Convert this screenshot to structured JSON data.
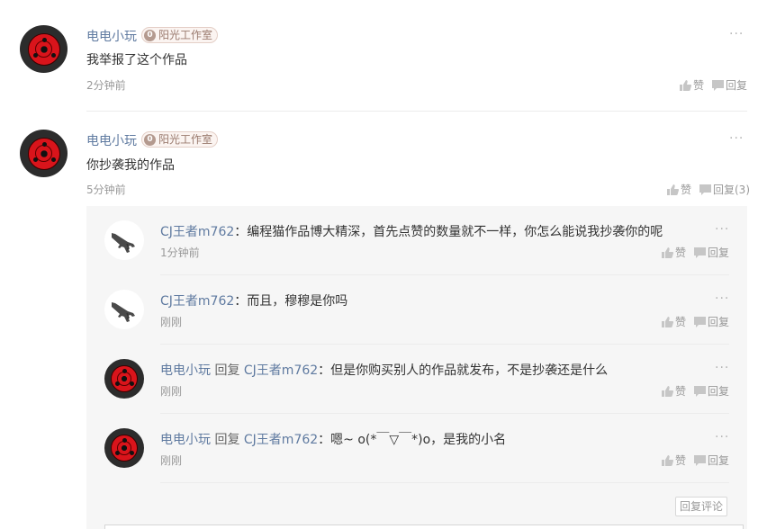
{
  "comments": [
    {
      "username": "电电小玩",
      "level": "0",
      "studio": "阳光工作室",
      "text": "我举报了这个作品",
      "time": "2分钟前",
      "like_label": "赞",
      "reply_label": "回复"
    },
    {
      "username": "电电小玩",
      "level": "0",
      "studio": "阳光工作室",
      "text": "你抄袭我的作品",
      "time": "5分钟前",
      "like_label": "赞",
      "reply_label": "回复(3)"
    }
  ],
  "replies": [
    {
      "username": "CJ王者m762",
      "reply_word": "",
      "reply_to": "",
      "text": "：编程猫作品博大精深，首先点赞的数量就不一样，你怎么能说我抄袭你的呢",
      "time": "1分钟前",
      "like_label": "赞",
      "reply_label": "回复"
    },
    {
      "username": "CJ王者m762",
      "reply_word": "",
      "reply_to": "",
      "text": "：而且，穆穆是你吗",
      "time": "刚刚",
      "like_label": "赞",
      "reply_label": "回复"
    },
    {
      "username": "电电小玩",
      "reply_word": "回复",
      "reply_to": "CJ王者m762",
      "text": "：但是你购买别人的作品就发布，不是抄袭还是什么",
      "time": "刚刚",
      "like_label": "赞",
      "reply_label": "回复"
    },
    {
      "username": "电电小玩",
      "reply_word": "回复",
      "reply_to": "CJ王者m762",
      "text": "：嗯~ o(*￣▽￣*)o，是我的小名",
      "time": "刚刚",
      "like_label": "赞",
      "reply_label": "回复"
    }
  ],
  "reply_comment_button": "回复评论",
  "more_label": "···",
  "icons": {
    "like": "thumbs-up-icon",
    "reply": "speech-bubble-icon",
    "more": "more-dots-icon"
  },
  "colors": {
    "username": "#5f7aa0",
    "reply_bg": "#f6f6f6",
    "avatar_red": "#d9141b"
  }
}
